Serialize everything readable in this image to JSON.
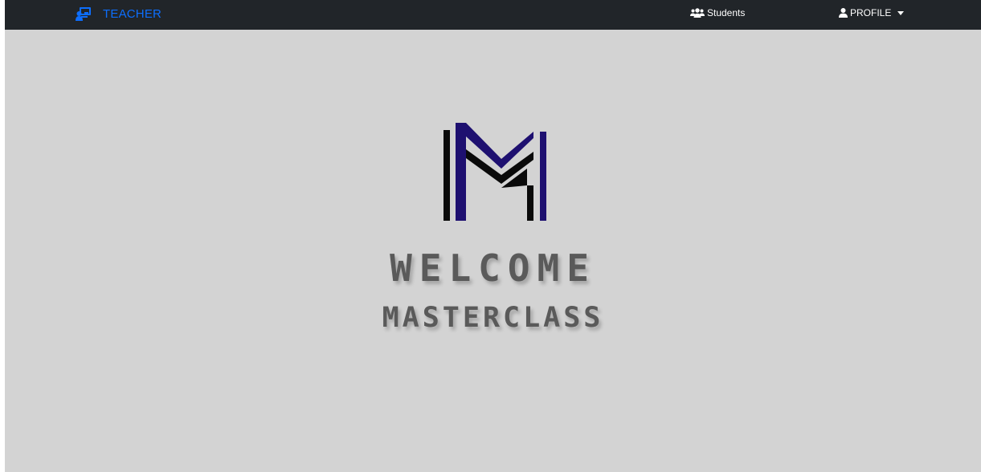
{
  "navbar": {
    "brand": {
      "label": "TEACHER",
      "icon": "chalkboard-teacher-icon",
      "color": "#0d6efd"
    },
    "students": {
      "label": "Students",
      "icon": "users-icon"
    },
    "profile": {
      "label": "PROFILE",
      "icon": "user-icon",
      "dropdown_icon": "caret-down-icon"
    },
    "background": "#212529"
  },
  "main": {
    "background": "#d3d3d3",
    "logo": {
      "icon": "masterclass-m-logo",
      "colors": {
        "primary": "#1e1070",
        "secondary": "#0a0a0a"
      }
    },
    "heading": "WELCOME",
    "subheading": "MASTERCLASS"
  }
}
